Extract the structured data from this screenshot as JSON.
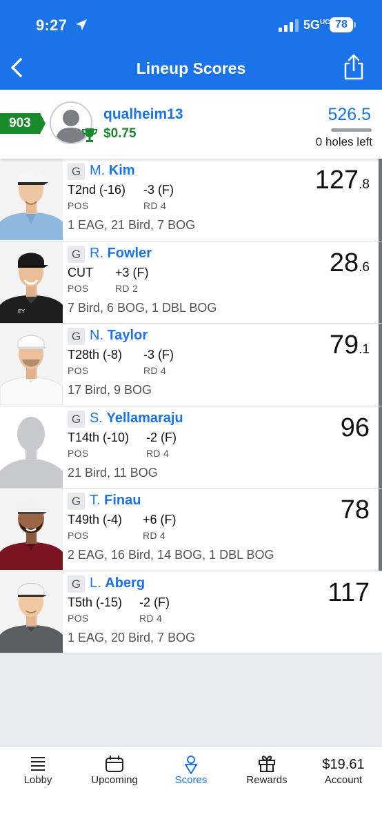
{
  "status": {
    "time": "9:27",
    "network": "5G",
    "network_suffix": "UC",
    "battery": "78"
  },
  "nav": {
    "title": "Lineup Scores"
  },
  "summary": {
    "rank": "903",
    "username": "qualheim13",
    "winnings": "$0.75",
    "total_score": "526.5",
    "holes_left": "0 holes left",
    "holes_progress": 1.0
  },
  "players": [
    {
      "pos_tag": "G",
      "initial": "M.",
      "last": "Kim",
      "position": "T2nd (-16)",
      "round_score": "-3 (F)",
      "pos_label": "POS",
      "round_label": "RD 4",
      "summary": "1 EAG, 21 Bird, 7 BOG",
      "score_int": "127",
      "score_dec": ".8"
    },
    {
      "pos_tag": "G",
      "initial": "R.",
      "last": "Fowler",
      "position": "CUT",
      "round_score": "+3 (F)",
      "pos_label": "POS",
      "round_label": "RD 2",
      "summary": "7 Bird, 6 BOG, 1 DBL BOG",
      "score_int": "28",
      "score_dec": ".6"
    },
    {
      "pos_tag": "G",
      "initial": "N.",
      "last": "Taylor",
      "position": "T28th (-8)",
      "round_score": "-3 (F)",
      "pos_label": "POS",
      "round_label": "RD 4",
      "summary": "17 Bird, 9 BOG",
      "score_int": "79",
      "score_dec": ".1"
    },
    {
      "pos_tag": "G",
      "initial": "S.",
      "last": "Yellamaraju",
      "position": "T14th (-10)",
      "round_score": "-2 (F)",
      "pos_label": "POS",
      "round_label": "RD 4",
      "summary": "21 Bird, 11 BOG",
      "score_int": "96",
      "score_dec": ""
    },
    {
      "pos_tag": "G",
      "initial": "T.",
      "last": "Finau",
      "position": "T49th (-4)",
      "round_score": "+6 (F)",
      "pos_label": "POS",
      "round_label": "RD 4",
      "summary": "2 EAG, 16 Bird, 14 BOG, 1 DBL BOG",
      "score_int": "78",
      "score_dec": ""
    },
    {
      "pos_tag": "G",
      "initial": "L.",
      "last": "Aberg",
      "position": "T5th (-15)",
      "round_score": "-2 (F)",
      "pos_label": "POS",
      "round_label": "RD 4",
      "summary": "1 EAG, 20 Bird, 7 BOG",
      "score_int": "117",
      "score_dec": ""
    }
  ],
  "tabs": {
    "lobby": "Lobby",
    "upcoming": "Upcoming",
    "scores": "Scores",
    "rewards": "Rewards",
    "account": "Account",
    "balance": "$19.61"
  },
  "colors": {
    "brand_blue": "#1a73e8",
    "green": "#188a2a"
  }
}
